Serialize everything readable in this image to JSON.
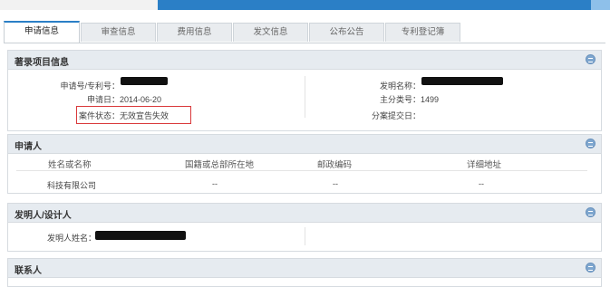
{
  "tabs": [
    {
      "label": "申请信息",
      "active": true
    },
    {
      "label": "审查信息",
      "active": false
    },
    {
      "label": "费用信息",
      "active": false
    },
    {
      "label": "发文信息",
      "active": false
    },
    {
      "label": "公布公告",
      "active": false
    },
    {
      "label": "专利登记簿",
      "active": false
    }
  ],
  "bibliographic": {
    "title": "著录项目信息",
    "app_no_label": "申请号/专利号：",
    "app_date_label": "申请日：",
    "app_date_value": "2014-06-20",
    "status_label": "案件状态：",
    "status_value": "无效宣告失效",
    "invention_name_label": "发明名称：",
    "main_class_label": "主分类号：",
    "main_class_value": "1499",
    "divisional_date_label": "分案提交日："
  },
  "applicant": {
    "title": "申请人",
    "columns": [
      "姓名或名称",
      "国籍或总部所在地",
      "邮政编码",
      "详细地址"
    ],
    "rows": [
      [
        "科技有限公司",
        "--",
        "--",
        "--"
      ]
    ]
  },
  "inventor": {
    "title": "发明人/设计人",
    "name_label": "发明人姓名："
  },
  "contact": {
    "title": "联系人"
  },
  "colors": {
    "accent": "#2b7fc6",
    "header_bg": "#e6ebf0",
    "highlight_box": "#d9383a"
  }
}
